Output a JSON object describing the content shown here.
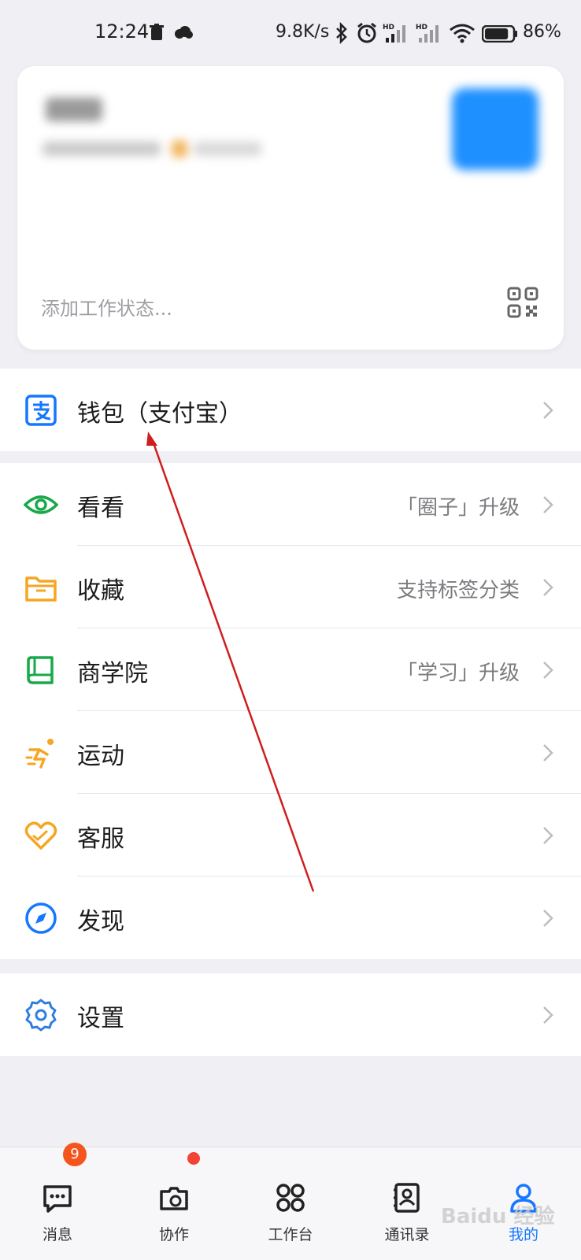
{
  "status_bar": {
    "time": "12:24",
    "speed": "9.8K/s",
    "battery": "86%",
    "battery_level": 0.86
  },
  "profile": {
    "status_placeholder": "添加工作状态..."
  },
  "menu": {
    "wallet": {
      "label": "钱包（支付宝）",
      "icon": "alipay-icon",
      "color": "#1677ff"
    },
    "items": [
      {
        "label": "看看",
        "hint": "「圈子」升级",
        "icon": "eye-icon",
        "color": "#19a84a"
      },
      {
        "label": "收藏",
        "hint": "支持标签分类",
        "icon": "folder-icon",
        "color": "#f5a623"
      },
      {
        "label": "商学院",
        "hint": "「学习」升级",
        "icon": "book-icon",
        "color": "#19a84a"
      },
      {
        "label": "运动",
        "hint": "",
        "icon": "running-icon",
        "color": "#f5a623"
      },
      {
        "label": "客服",
        "hint": "",
        "icon": "heart-icon",
        "color": "#f5a623"
      },
      {
        "label": "发现",
        "hint": "",
        "icon": "compass-icon",
        "color": "#1677ff"
      }
    ],
    "settings": {
      "label": "设置",
      "icon": "gear-icon",
      "color": "#2f7de1"
    }
  },
  "bottom_nav": {
    "items": [
      {
        "label": "消息",
        "icon": "message-icon",
        "badge": "9"
      },
      {
        "label": "协作",
        "icon": "collab-icon"
      },
      {
        "label": "工作台",
        "icon": "workbench-icon"
      },
      {
        "label": "通讯录",
        "icon": "contacts-icon"
      },
      {
        "label": "我的",
        "icon": "profile-icon",
        "active": true
      }
    ]
  },
  "watermark": "Baidu 经验"
}
